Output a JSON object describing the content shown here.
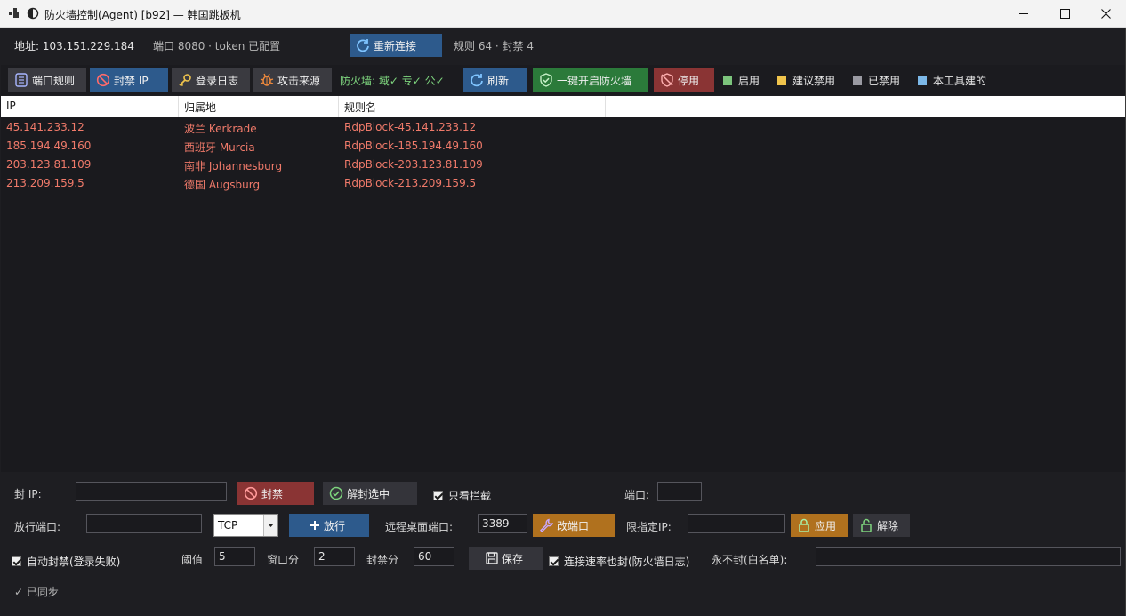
{
  "window": {
    "title": "防火墙控制(Agent) [b92] — 韩国跳板机",
    "minimize_icon": "minimize-icon",
    "maximize_icon": "maximize-icon",
    "close_icon": "close-icon"
  },
  "info": {
    "address": "地址: 103.151.229.184",
    "port_token": "端口 8080 · token 已配置",
    "reconnect_label": "重新连接",
    "stats": "规则 64 · 封禁 4"
  },
  "toolbar": {
    "port_rules_label": "端口规则",
    "ban_ip_label": "封禁 IP",
    "login_log_label": "登录日志",
    "attack_source_label": "攻击来源",
    "firewall_status": "防火墙: 域✓ 专✓ 公✓",
    "refresh_label": "刷新",
    "enable_fw_label": "一键开启防火墙",
    "disable_label": "停用",
    "legend": [
      {
        "label": "启用",
        "color": "#7cc47c"
      },
      {
        "label": "建议禁用",
        "color": "#f0c44c"
      },
      {
        "label": "已禁用",
        "color": "#9a9aa2"
      },
      {
        "label": "本工具建的",
        "color": "#7cb8e8"
      }
    ]
  },
  "table": {
    "headers": [
      "IP",
      "归属地",
      "规则名"
    ],
    "rows": [
      {
        "ip": "45.141.233.12",
        "location": "波兰 Kerkrade",
        "rule": "RdpBlock-45.141.233.12"
      },
      {
        "ip": "185.194.49.160",
        "location": "西班牙 Murcia",
        "rule": "RdpBlock-185.194.49.160"
      },
      {
        "ip": "203.123.81.109",
        "location": "南非 Johannesburg",
        "rule": "RdpBlock-203.123.81.109"
      },
      {
        "ip": "213.209.159.5",
        "location": "德国 Augsburg",
        "rule": "RdpBlock-213.209.159.5"
      }
    ],
    "row_color": "#f07a6a"
  },
  "bottom": {
    "ban_ip_label": "封 IP:",
    "ban_ip_value": "",
    "ban_button": "封禁",
    "unban_selected_button": "解封选中",
    "only_blocked_label": "只看拦截",
    "port_label": "端口:",
    "port_value": "",
    "allow_port_label": "放行端口:",
    "allow_port_value": "",
    "protocol_value": "TCP",
    "allow_button": "放行",
    "rdp_port_label": "远程桌面端口:",
    "rdp_port_value": "3389",
    "change_port_button": "改端口",
    "limit_ip_label": "限指定IP:",
    "limit_ip_value": "",
    "apply_button": "应用",
    "release_button": "解除",
    "auto_ban_label": "自动封禁(登录失败)",
    "threshold_label": "阈值",
    "threshold_value": "5",
    "window_label": "窗口分",
    "window_value": "2",
    "ban_minutes_label": "封禁分",
    "ban_minutes_value": "60",
    "save_button": "保存",
    "rate_ban_label": "连接速率也封(防火墙日志)",
    "whitelist_label": "永不封(白名单):",
    "whitelist_value": "",
    "status": "✓ 已同步"
  }
}
